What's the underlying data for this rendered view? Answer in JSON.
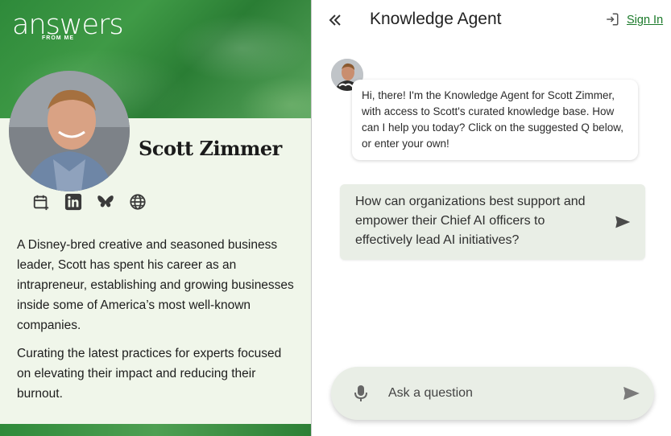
{
  "brand": {
    "logo_main": "answers",
    "logo_sub": "FROM ME"
  },
  "profile": {
    "name": "Scott Zimmer",
    "social_icons": [
      "calendar-add-icon",
      "linkedin-icon",
      "bluesky-icon",
      "globe-icon"
    ],
    "bio": [
      "A Disney-bred creative and seasoned business leader, Scott has spent his career as an intrapreneur, establishing and growing businesses inside some of America’s most well-known companies.",
      "Curating the latest practices for experts focused on elevating their impact and reducing their burnout."
    ]
  },
  "header": {
    "title": "Knowledge Agent",
    "signin_label": "Sign In"
  },
  "chat": {
    "greeting": "Hi, there! I'm the Knowledge Agent for Scott Zimmer, with access to Scott's curated knowledge base. How can I help you today? Click on the suggested Q below, or enter your own!",
    "suggested_question": "How can organizations best support and empower their Chief AI officers to effectively lead AI initiatives?"
  },
  "input": {
    "placeholder": "Ask a question"
  },
  "colors": {
    "brand_green": "#2e8a3a",
    "panel_bg": "#f0f6ea",
    "bubble_bg": "#e9eee6",
    "link_green": "#1b7a2a"
  }
}
